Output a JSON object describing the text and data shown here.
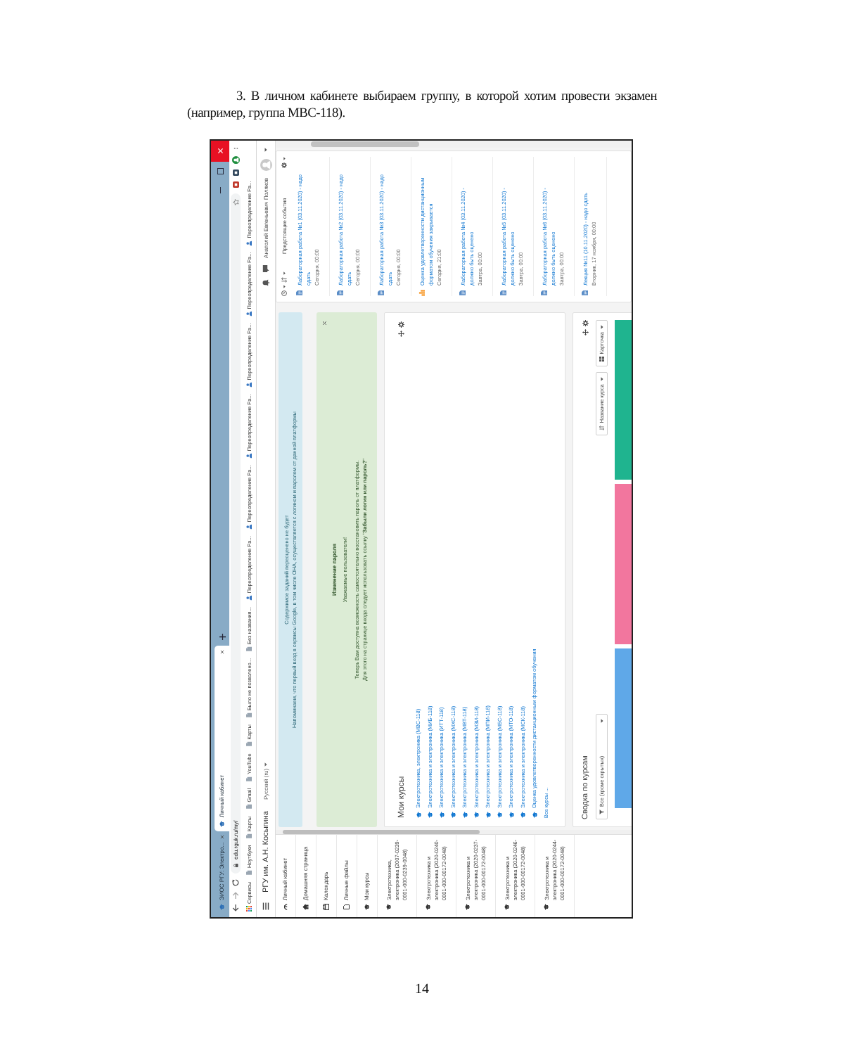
{
  "instruction": {
    "text": "3. В личном кабинете выбираем группу, в которой хотим провести экзамен (например, группа МВС-118)."
  },
  "screenshot": {
    "tabs": [
      {
        "label": "ЭИОС РГУ: Электро...",
        "selected": false
      },
      {
        "label": "Личный кабинет",
        "selected": true
      }
    ],
    "address_bar": {
      "url": "edu.rguk.ru/my/"
    },
    "bookmarks": [
      {
        "label": "Сервисы",
        "kind": "apps"
      },
      {
        "label": "Ноутбуки",
        "kind": "page"
      },
      {
        "label": "Карты",
        "kind": "page"
      },
      {
        "label": "Gmail",
        "kind": "page"
      },
      {
        "label": "YouTube",
        "kind": "page"
      },
      {
        "label": "Карты",
        "kind": "page"
      },
      {
        "label": "Было не позволено...",
        "kind": "page"
      },
      {
        "label": "Без названия...",
        "kind": "page"
      },
      {
        "label": "Переопределение Ра...",
        "kind": "person"
      },
      {
        "label": "Переопределение Ра...",
        "kind": "person"
      },
      {
        "label": "Переопределение Ра...",
        "kind": "person"
      },
      {
        "label": "Переопределение Ра...",
        "kind": "person"
      },
      {
        "label": "Переопределение Ра...",
        "kind": "person"
      },
      {
        "label": "Переопределение Ра...",
        "kind": "person"
      }
    ],
    "header": {
      "site_name": "РГУ им. А.Н. Косыгина",
      "language": "Русский (ru)",
      "user_name": "Анатолий Евгеньевич Поляков"
    },
    "sidebar": {
      "items": [
        {
          "label": "Личный кабинет",
          "kind": "dashboard"
        },
        {
          "label": "Домашняя страница",
          "kind": "home"
        },
        {
          "label": "Календарь",
          "kind": "calendar"
        },
        {
          "label": "Личные файлы",
          "kind": "files"
        },
        {
          "label": "Мои курсы",
          "kind": "courses"
        },
        {
          "label": "Электротехника, электроника (2007-0239-0001-000-0239-0048)",
          "kind": "course"
        },
        {
          "label": "Электротехника и электроника (2020-0240-0001-000-00172-0048)",
          "kind": "course"
        },
        {
          "label": "Электротехника и электроника (2020-0237-0001-000-00172-0048)",
          "kind": "course"
        },
        {
          "label": "Электротехника и электроника (2020-0246-0001-000-00172-0048)",
          "kind": "course"
        },
        {
          "label": "Электротехника и электроника (2020-0244-0001-000-00172-0048)",
          "kind": "course"
        }
      ]
    },
    "notices": [
      {
        "kind": "info",
        "lines": [
          "Содержимое заданий переоценено не будет",
          "Напоминаем, что первый вход в сервисы Google, в том числе ОНА, осуществляется с логином и паролем от данной платформы"
        ]
      },
      {
        "kind": "success",
        "title": "Изменение пароля",
        "dismissible": true,
        "lines": [
          "Уважаемые пользователи!",
          "Теперь Вам доступна возможность самостоятельно восстановить пароль от платформы.",
          "Для этого на странице входа следует использовать ссылку \"**Забыли логин или пароль?**\""
        ]
      }
    ],
    "my_courses": {
      "title": "Мои курсы",
      "courses": [
        "Электротехника, электроника (МВС-118)",
        "Электротехника и электроника (МИБ-118)",
        "Электротехника и электроника (ИТТ-118)",
        "Электротехника и электроника (МХС-118)",
        "Электротехника и электроника (МВТ-118)",
        "Электротехника и электроника (МЗИ-118)",
        "Электротехника и электроника (МПИ-118)",
        "Электротехника и электроника (МБС-118)",
        "Электротехника и электроника (МТО-118)",
        "Электротехника и электроника (МСК-118)",
        "Оценка удовлетворенности дистанционным форматом обучения"
      ],
      "more_link": "Все курсы ..."
    },
    "course_overview": {
      "title": "Сводка по курсам",
      "filter": "Все (кроме скрытых)",
      "sort": "Название курса",
      "view": "Карточка",
      "cards": [
        {
          "color": "#5fa8e8"
        },
        {
          "color": "#f2769e"
        },
        {
          "color": "#1fb48f"
        }
      ]
    },
    "upcoming": {
      "title": "Предстоящие события",
      "events": [
        {
          "kind": "assignment",
          "title": "Лабораторная работа №1 (03.11.2020) - надо сдать",
          "when": "Сегодня, 00:00"
        },
        {
          "kind": "assignment",
          "title": "Лабораторная работа №2 (03.11.2020) - надо сдать",
          "when": "Сегодня, 00:00"
        },
        {
          "kind": "assignment",
          "title": "Лабораторная работа №3 (03.11.2020) - надо сдать",
          "when": "Сегодня, 00:00"
        },
        {
          "kind": "feedback",
          "title": "Оценка удовлетворенности дистанционным форматом обучения закрывается",
          "when": "Сегодня, 21:00"
        },
        {
          "kind": "assignment",
          "title": "Лабораторная работа №4 (03.11.2020) - должно быть оценено",
          "when": "Завтра, 00:00"
        },
        {
          "kind": "assignment",
          "title": "Лабораторная работа №5 (03.11.2020) - должно быть оценено",
          "when": "Завтра, 00:00"
        },
        {
          "kind": "assignment",
          "title": "Лабораторная работа №6 (03.11.2020) - должно быть оценено",
          "when": "Завтра, 00:00"
        },
        {
          "kind": "assignment",
          "title": "Лекция №11 (10.11.2020) - надо сдать",
          "when": "Вторник, 17 ноября, 00:00"
        }
      ]
    }
  },
  "page_number": "14"
}
